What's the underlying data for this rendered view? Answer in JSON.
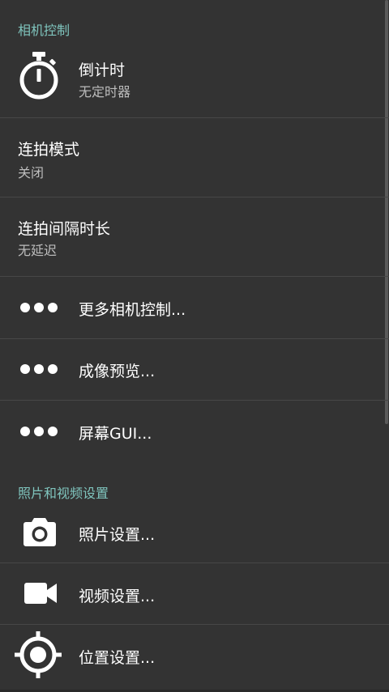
{
  "sections": {
    "camera_controls": "相机控制",
    "photo_video_settings": "照片和视频设置"
  },
  "items": {
    "timer": {
      "title": "倒计时",
      "summary": "无定时器",
      "icon": "stopwatch-icon"
    },
    "burst_mode": {
      "title": "连拍模式",
      "summary": "关闭"
    },
    "burst_interval": {
      "title": "连拍间隔时长",
      "summary": "无延迟"
    },
    "more_camera_controls": {
      "title": "更多相机控制...",
      "icon": "more-dots-icon"
    },
    "preview": {
      "title": "成像预览...",
      "icon": "more-dots-icon"
    },
    "on_screen_gui": {
      "title": "屏幕GUI...",
      "icon": "more-dots-icon"
    },
    "photo_settings": {
      "title": "照片设置...",
      "icon": "camera-icon"
    },
    "video_settings": {
      "title": "视频设置...",
      "icon": "video-camera-icon"
    },
    "location_settings": {
      "title": "位置设置...",
      "icon": "location-crosshair-icon"
    }
  },
  "colors": {
    "background": "#333333",
    "section_header": "#7fc4bd",
    "title": "#ffffff",
    "summary": "#bdbdbd",
    "divider": "#474747"
  }
}
